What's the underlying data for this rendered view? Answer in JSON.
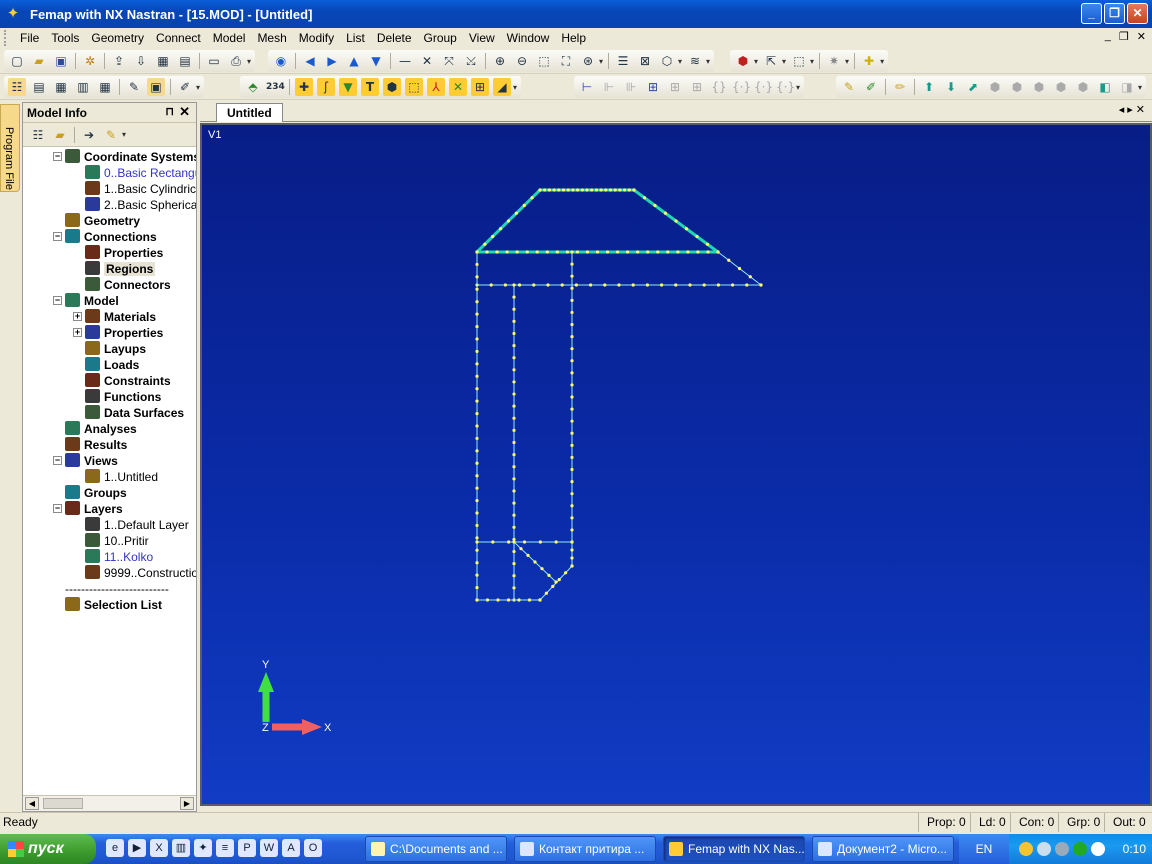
{
  "window": {
    "title": "Femap with NX Nastran - [15.MOD] - [Untitled]"
  },
  "menu": [
    "File",
    "Tools",
    "Geometry",
    "Connect",
    "Model",
    "Mesh",
    "Modify",
    "List",
    "Delete",
    "Group",
    "View",
    "Window",
    "Help"
  ],
  "model_info": {
    "title": "Model Info",
    "tree": [
      {
        "label": "Coordinate Systems",
        "bold": true,
        "level": 0,
        "exp": "−"
      },
      {
        "label": "0..Basic Rectangular",
        "bold": false,
        "level": 1,
        "blue": true
      },
      {
        "label": "1..Basic Cylindrical",
        "bold": false,
        "level": 1
      },
      {
        "label": "2..Basic Spherical",
        "bold": false,
        "level": 1
      },
      {
        "label": "Geometry",
        "bold": true,
        "level": 0
      },
      {
        "label": "Connections",
        "bold": true,
        "level": 0,
        "exp": "−"
      },
      {
        "label": "Properties",
        "bold": true,
        "level": 1
      },
      {
        "label": "Regions",
        "bold": true,
        "level": 1,
        "selected": true
      },
      {
        "label": "Connectors",
        "bold": true,
        "level": 1
      },
      {
        "label": "Model",
        "bold": true,
        "level": 0,
        "exp": "−"
      },
      {
        "label": "Materials",
        "bold": true,
        "level": 1,
        "exp": "+"
      },
      {
        "label": "Properties",
        "bold": true,
        "level": 1,
        "exp": "+"
      },
      {
        "label": "Layups",
        "bold": true,
        "level": 1
      },
      {
        "label": "Loads",
        "bold": true,
        "level": 1
      },
      {
        "label": "Constraints",
        "bold": true,
        "level": 1
      },
      {
        "label": "Functions",
        "bold": true,
        "level": 1
      },
      {
        "label": "Data Surfaces",
        "bold": true,
        "level": 1
      },
      {
        "label": "Analyses",
        "bold": true,
        "level": 0
      },
      {
        "label": "Results",
        "bold": true,
        "level": 0
      },
      {
        "label": "Views",
        "bold": true,
        "level": 0,
        "exp": "−"
      },
      {
        "label": "1..Untitled",
        "bold": false,
        "level": 1
      },
      {
        "label": "Groups",
        "bold": true,
        "level": 0
      },
      {
        "label": "Layers",
        "bold": true,
        "level": 0,
        "exp": "−"
      },
      {
        "label": "1..Default Layer",
        "bold": false,
        "level": 1
      },
      {
        "label": "10..Pritir",
        "bold": false,
        "level": 1
      },
      {
        "label": "11..Kolko",
        "bold": false,
        "level": 1,
        "blue": true
      },
      {
        "label": "9999..Construction Layer",
        "bold": false,
        "level": 1
      },
      {
        "label": "--------------------------",
        "bold": false,
        "level": 0
      },
      {
        "label": "Selection List",
        "bold": true,
        "level": 0
      }
    ]
  },
  "program_file_tab": "Program File",
  "view": {
    "tab": "Untitled",
    "label": "V1",
    "axis_y": "Y",
    "axis_x": "X",
    "axis_z": "Z"
  },
  "status": {
    "ready": "Ready",
    "prop": "Prop: 0",
    "ld": "Ld: 0",
    "con": "Con: 0",
    "grp": "Grp: 0",
    "out": "Out: 0"
  },
  "taskbar": {
    "start": "пуск",
    "buttons": [
      "C:\\Documents and ...",
      "Контакт притира ...",
      "Femap with NX Nas...",
      "Документ2 - Micro..."
    ],
    "active_index": 2,
    "lang": "EN",
    "clock": "0:10"
  },
  "colors": {
    "canvas_top": "#081d86",
    "canvas_bottom": "#113cc4",
    "node": "#ffff66",
    "edge": "#8fe8ff",
    "thick_edge": "#22d6b0"
  }
}
